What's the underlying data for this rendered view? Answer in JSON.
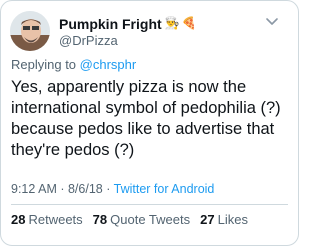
{
  "author": {
    "display_name": "Pumpkin Fright",
    "emoji_1": "👨‍🍳",
    "emoji_2": "🍕",
    "handle": "@DrPizza"
  },
  "reply": {
    "prefix": "Replying to ",
    "mention": "@chrsphr"
  },
  "tweet": {
    "text": "Yes, apparently pizza is now the\ninternational symbol of pedophilia (?)\nbecause pedos like to advertise that\nthey're pedos (?)"
  },
  "meta": {
    "time": "9:12 AM",
    "separator_1": " · ",
    "date": "8/6/18",
    "separator_2": " · ",
    "source": "Twitter for Android"
  },
  "stats": {
    "retweets_count": "28",
    "retweets_label": "Retweets",
    "quotes_count": "78",
    "quotes_label": "Quote Tweets",
    "likes_count": "27",
    "likes_label": "Likes"
  },
  "colors": {
    "link": "#1d9bf0",
    "secondary_text": "#536471",
    "primary_text": "#0f1419",
    "border": "#cfd9de"
  },
  "icons": {
    "avatar": "avatar",
    "more": "chevron-down-icon"
  }
}
